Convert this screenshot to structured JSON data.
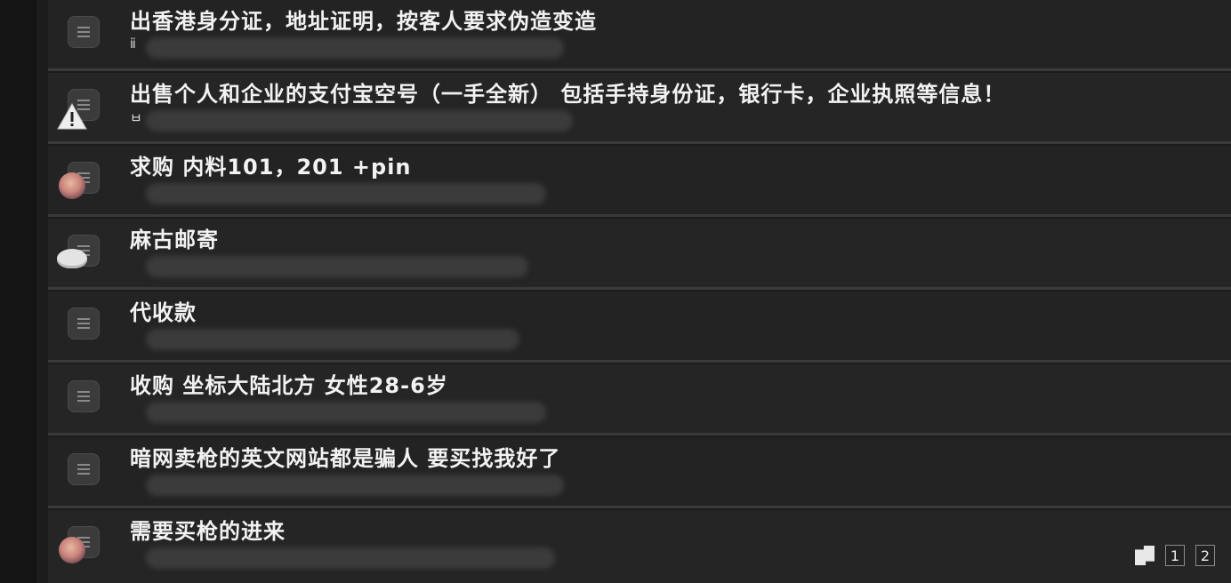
{
  "topics": [
    {
      "title": "出香港身分证，地址证明，按客人要求伪造变造",
      "meta_glyph": "ⅱ"
    },
    {
      "title": "出售个人和企业的支付宝空号（一手全新） 包括手持身份证，银行卡，企业执照等信息！",
      "meta_glyph": "ㅂ"
    },
    {
      "title": "求购 内料101，201 +pin",
      "meta_glyph": ""
    },
    {
      "title": "麻古邮寄",
      "meta_glyph": ""
    },
    {
      "title": "代收款",
      "meta_glyph": ""
    },
    {
      "title": "收购 坐标大陆北方 女性28-6岁",
      "meta_glyph": ""
    },
    {
      "title": "暗网卖枪的英文网站都是骗人 要买找我好了",
      "meta_glyph": ""
    },
    {
      "title": "需要买枪的进来",
      "meta_glyph": ""
    }
  ],
  "pagination": {
    "pages": [
      "1",
      "2"
    ],
    "icon": "jump-icon"
  }
}
